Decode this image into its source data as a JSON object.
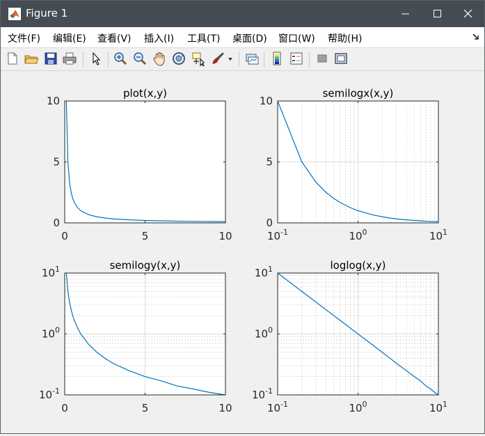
{
  "window": {
    "title": "Figure 1",
    "controls": [
      "minimize",
      "maximize",
      "close"
    ]
  },
  "menu": {
    "items": [
      "文件(F)",
      "编辑(E)",
      "查看(V)",
      "插入(I)",
      "工具(T)",
      "桌面(D)",
      "窗口(W)",
      "帮助(H)"
    ]
  },
  "toolbar": {
    "icons": [
      "new-figure-icon",
      "open-folder-icon",
      "save-icon",
      "print-icon",
      "select-arrow-icon",
      "zoom-in-icon",
      "zoom-out-icon",
      "pan-hand-icon",
      "rotate-3d-icon",
      "data-cursor-icon",
      "brush-icon",
      "brush-dropdown-icon",
      "link-plot-icon",
      "colorbar-icon",
      "legend-icon",
      "hide-plot-tools-icon",
      "show-plot-tools-icon"
    ]
  },
  "colors": {
    "line": "#0072bd",
    "titlebar": "#454c53",
    "figure_bg": "#f0f0f0"
  },
  "chart_data": [
    {
      "type": "line",
      "title": "plot(x,y)",
      "xscale": "linear",
      "yscale": "linear",
      "xlim": [
        0,
        10
      ],
      "ylim": [
        0,
        10
      ],
      "xticks": [
        "0",
        "5",
        "10"
      ],
      "yticks": [
        "0",
        "5",
        "10"
      ],
      "grid": false,
      "series": [
        {
          "x": [
            0.1,
            0.2,
            0.3,
            0.4,
            0.5,
            0.6,
            0.8,
            1,
            1.5,
            2,
            2.5,
            3,
            4,
            5,
            6,
            7,
            8,
            9,
            10
          ],
          "y": [
            10,
            5,
            3.33,
            2.5,
            2,
            1.67,
            1.25,
            1,
            0.67,
            0.5,
            0.4,
            0.33,
            0.25,
            0.2,
            0.17,
            0.14,
            0.125,
            0.11,
            0.1
          ]
        }
      ]
    },
    {
      "type": "line",
      "title": "semilogx(x,y)",
      "xscale": "log",
      "yscale": "linear",
      "xlim": [
        0.1,
        10
      ],
      "ylim": [
        0,
        10
      ],
      "xticks": [
        "10^-1",
        "10^0",
        "10^1"
      ],
      "yticks": [
        "0",
        "5",
        "10"
      ],
      "grid": true,
      "series": [
        {
          "x": [
            0.1,
            0.2,
            0.3,
            0.4,
            0.5,
            0.6,
            0.8,
            1,
            1.5,
            2,
            2.5,
            3,
            4,
            5,
            6,
            7,
            8,
            9,
            10
          ],
          "y": [
            10,
            5,
            3.33,
            2.5,
            2,
            1.67,
            1.25,
            1,
            0.67,
            0.5,
            0.4,
            0.33,
            0.25,
            0.2,
            0.17,
            0.14,
            0.125,
            0.11,
            0.1
          ]
        }
      ]
    },
    {
      "type": "line",
      "title": "semilogy(x,y)",
      "xscale": "linear",
      "yscale": "log",
      "xlim": [
        0,
        10
      ],
      "ylim": [
        0.1,
        10
      ],
      "xticks": [
        "0",
        "5",
        "10"
      ],
      "yticks": [
        "10^-1",
        "10^0",
        "10^1"
      ],
      "grid": true,
      "series": [
        {
          "x": [
            0.1,
            0.2,
            0.3,
            0.4,
            0.5,
            0.6,
            0.8,
            1,
            1.5,
            2,
            2.5,
            3,
            4,
            5,
            6,
            7,
            8,
            9,
            10
          ],
          "y": [
            10,
            5,
            3.33,
            2.5,
            2,
            1.67,
            1.25,
            1,
            0.67,
            0.5,
            0.4,
            0.33,
            0.25,
            0.2,
            0.17,
            0.14,
            0.125,
            0.11,
            0.1
          ]
        }
      ]
    },
    {
      "type": "line",
      "title": "loglog(x,y)",
      "xscale": "log",
      "yscale": "log",
      "xlim": [
        0.1,
        10
      ],
      "ylim": [
        0.1,
        10
      ],
      "xticks": [
        "10^-1",
        "10^0",
        "10^1"
      ],
      "yticks": [
        "10^-1",
        "10^0",
        "10^1"
      ],
      "grid": true,
      "series": [
        {
          "x": [
            0.1,
            0.2,
            0.3,
            0.4,
            0.5,
            0.6,
            0.8,
            1,
            1.5,
            2,
            2.5,
            3,
            4,
            5,
            6,
            7,
            8,
            9,
            10
          ],
          "y": [
            10,
            5,
            3.33,
            2.5,
            2,
            1.67,
            1.25,
            1,
            0.67,
            0.5,
            0.4,
            0.33,
            0.25,
            0.2,
            0.17,
            0.14,
            0.125,
            0.11,
            0.1
          ]
        }
      ]
    }
  ]
}
